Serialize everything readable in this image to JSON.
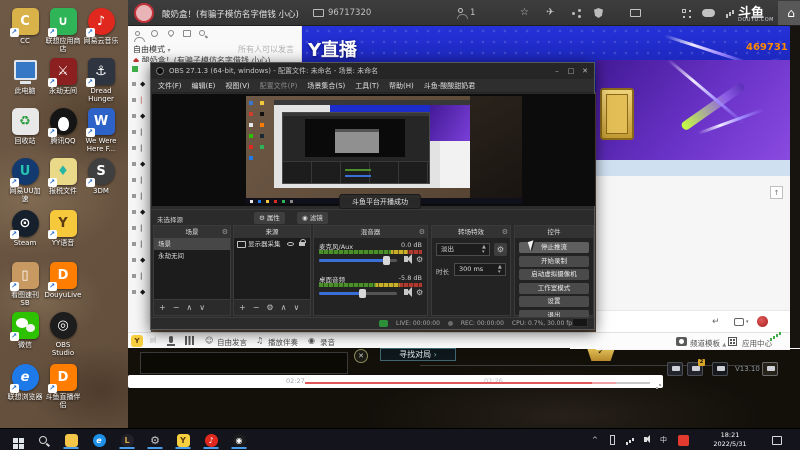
{
  "icons": {
    "shortcut": "↗",
    "gear": "⚙",
    "star": "☆",
    "plane": "✈",
    "home": "⌂",
    "note": "♪",
    "note2": "♫",
    "smiley": "☺",
    "record": "◉",
    "check": "✓",
    "close": "✕",
    "min": "–",
    "max": "□",
    "up": "∧",
    "down": "∨",
    "plus": "+",
    "minus": "−",
    "caret_down": "▾",
    "caret_up": "▲",
    "arrow_up": "↑",
    "enter": "↵",
    "chevron": "^",
    "chev_right": "›",
    "ime": "中"
  },
  "desktop": {
    "icons": [
      {
        "label": "CC",
        "glyph": "C"
      },
      {
        "label": "联想应用商店",
        "glyph": "∪"
      },
      {
        "label": "网易云音乐",
        "glyph": "♪"
      },
      {
        "label": "此电脑",
        "glyph": ""
      },
      {
        "label": "永劫无间",
        "glyph": "⚔"
      },
      {
        "label": "Dread Hunger",
        "glyph": "⚓"
      },
      {
        "label": "回收站",
        "glyph": "♻"
      },
      {
        "label": "腾讯QQ",
        "glyph": ""
      },
      {
        "label": "We Were Here F...",
        "glyph": "W"
      },
      {
        "label": "网易UU加速",
        "glyph": "U"
      },
      {
        "label": "报税文件",
        "glyph": "♦"
      },
      {
        "label": "3DM",
        "glyph": "S"
      },
      {
        "label": "Steam",
        "glyph": "⊙"
      },
      {
        "label": "YY语音",
        "glyph": "Y"
      },
      {
        "label": "看图速刊 SB",
        "glyph": "▯"
      },
      {
        "label": "DouyuLive",
        "glyph": "D"
      },
      {
        "label": "微信",
        "glyph": ""
      },
      {
        "label": "OBS Studio",
        "glyph": "◎"
      },
      {
        "label": "联想浏览器",
        "glyph": "e"
      },
      {
        "label": "斗鱼直播伴侣",
        "glyph": "D"
      }
    ]
  },
  "titlebar": {
    "title": "酸奶盒！(有骗子模仿名字借钱 小心)",
    "room_id": "96717320",
    "viewers": "1",
    "logo_cn": "斗鱼",
    "logo_en": "DOUYU.COM"
  },
  "banner": {
    "text": "Y直播",
    "number": "469731"
  },
  "yy": {
    "mode": "自由模式",
    "hint": "所有人可以发言",
    "channel": "酸奶盒！(有骗子模仿名字借钱 小心)",
    "tree": [
      "◆",
      "|",
      "◆",
      "|",
      "|",
      "◆",
      "|",
      "|",
      "◆",
      "|",
      "|",
      "◆",
      "|",
      "◆"
    ],
    "toolbar": {
      "speak": "自由发言",
      "accompany": "播放伴奏",
      "record": "录音"
    }
  },
  "obs": {
    "title": "OBS 27.1.3 (64-bit, windows) - 配置文件: 未命名 - 场景: 未命名",
    "menus": [
      "文件(F)",
      "编辑(E)",
      "视图(V)",
      "配置文件(P)",
      "场景集合(S)",
      "工具(T)",
      "帮助(H)",
      "斗鱼-酸酸甜奶君"
    ],
    "toast": "斗鱼平台开播成功",
    "no_source_hint": "未选择源",
    "properties": "属性",
    "filters": "滤镜",
    "scenes": {
      "title": "场景",
      "items": [
        "场景",
        "永劫无间"
      ]
    },
    "sources": {
      "title": "来源",
      "item": "显示器采集"
    },
    "mixer": {
      "title": "混音器",
      "ch1_name": "麦克风/Aux",
      "ch1_db": "0.0 dB",
      "ch2_name": "桌面音频",
      "ch2_db": "-5.8 dB"
    },
    "transitions": {
      "title": "转场特效",
      "value": "淡出",
      "duration_label": "时长",
      "duration": "300 ms"
    },
    "controls": {
      "title": "控件",
      "buttons": [
        "停止推流",
        "开始录制",
        "启动虚拟摄像机",
        "工作室模式",
        "设置",
        "退出"
      ]
    },
    "status": {
      "live": "LIVE: 00:00:00",
      "rec": "REC: 00:00:00",
      "cpu": "CPU: 0.7%, 30.00 fps"
    }
  },
  "panel": {
    "template": "频道模板",
    "app_center": "应用中心"
  },
  "game": {
    "find": "寻找对局",
    "badge": "2",
    "version": "V13.10",
    "t1": "02:27",
    "t2": "02:26"
  },
  "taskbar": {
    "time": "18:21",
    "date": "2022/5/31"
  }
}
